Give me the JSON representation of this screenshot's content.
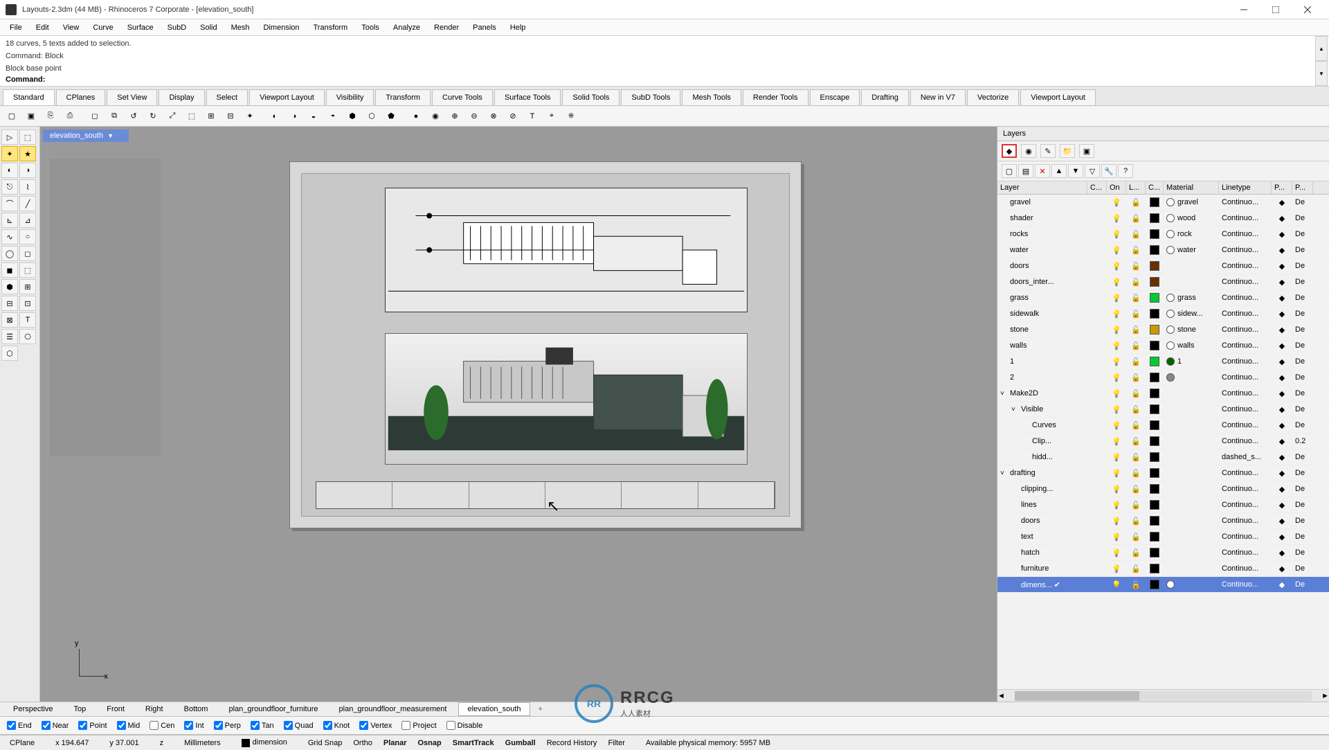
{
  "window": {
    "title": "Layouts-2.3dm (44 MB) - Rhinoceros 7 Corporate - [elevation_south]"
  },
  "menu": [
    "File",
    "Edit",
    "View",
    "Curve",
    "Surface",
    "SubD",
    "Solid",
    "Mesh",
    "Dimension",
    "Transform",
    "Tools",
    "Analyze",
    "Render",
    "Panels",
    "Help"
  ],
  "command_history": [
    "18 curves, 5 texts added to selection.",
    "Command: Block",
    "Block base point"
  ],
  "command_prompt": "Command:",
  "tabs": [
    "Standard",
    "CPlanes",
    "Set View",
    "Display",
    "Select",
    "Viewport Layout",
    "Visibility",
    "Transform",
    "Curve Tools",
    "Surface Tools",
    "Solid Tools",
    "SubD Tools",
    "Mesh Tools",
    "Render Tools",
    "Enscape",
    "Drafting",
    "New in V7",
    "Vectorize",
    "Viewport Layout"
  ],
  "viewport": {
    "name": "elevation_south",
    "axes": {
      "x": "x",
      "y": "y"
    }
  },
  "layers_panel": {
    "title": "Layers",
    "columns": [
      "Layer",
      "C...",
      "On",
      "L...",
      "C...",
      "Material",
      "Linetype",
      "P...",
      "P..."
    ],
    "rows": [
      {
        "name": "gravel",
        "color": "#000000",
        "material": "gravel",
        "linetype": "Continuo...",
        "pc": "De"
      },
      {
        "name": "shader",
        "color": "#000000",
        "material": "wood",
        "linetype": "Continuo...",
        "pc": "De"
      },
      {
        "name": "rocks",
        "color": "#000000",
        "material": "rock",
        "linetype": "Continuo...",
        "pc": "De"
      },
      {
        "name": "water",
        "color": "#000000",
        "material": "water",
        "linetype": "Continuo...",
        "pc": "De"
      },
      {
        "name": "doors",
        "color": "#663300",
        "material": "",
        "linetype": "Continuo...",
        "pc": "De"
      },
      {
        "name": "doors_inter...",
        "color": "#663300",
        "material": "",
        "linetype": "Continuo...",
        "pc": "De"
      },
      {
        "name": "grass",
        "color": "#00cc33",
        "material": "grass",
        "linetype": "Continuo...",
        "pc": "De",
        "prcolor": "#00cc33"
      },
      {
        "name": "sidewalk",
        "color": "#000000",
        "material": "sidew...",
        "linetype": "Continuo...",
        "pc": "De"
      },
      {
        "name": "stone",
        "color": "#cc9900",
        "material": "stone",
        "linetype": "Continuo...",
        "pc": "De"
      },
      {
        "name": "walls",
        "color": "#000000",
        "material": "walls",
        "linetype": "Continuo...",
        "pc": "De"
      },
      {
        "name": "1",
        "color": "#00cc33",
        "material": "1",
        "linetype": "Continuo...",
        "pc": "De",
        "matcolor": "#006600"
      },
      {
        "name": "2",
        "color": "#000000",
        "material": "",
        "linetype": "Continuo...",
        "pc": "De",
        "matcolor": "#888888"
      },
      {
        "name": "Make2D",
        "color": "#000000",
        "material": "",
        "linetype": "Continuo...",
        "pc": "De",
        "expandable": true,
        "expanded": true
      },
      {
        "name": "Visible",
        "color": "#000000",
        "material": "",
        "linetype": "Continuo...",
        "pc": "De",
        "indent": 1,
        "expandable": true,
        "expanded": true
      },
      {
        "name": "Curves",
        "color": "#000000",
        "material": "",
        "linetype": "Continuo...",
        "pc": "De",
        "indent": 2
      },
      {
        "name": "Clip...",
        "color": "#000000",
        "material": "",
        "linetype": "Continuo...",
        "pc": "0.2",
        "indent": 2
      },
      {
        "name": "hidd...",
        "color": "#000000",
        "material": "",
        "linetype": "dashed_s...",
        "pc": "De",
        "indent": 2
      },
      {
        "name": "drafting",
        "color": "#000000",
        "material": "",
        "linetype": "Continuo...",
        "pc": "De",
        "expandable": true,
        "expanded": true
      },
      {
        "name": "clipping...",
        "color": "#000000",
        "material": "",
        "linetype": "Continuo...",
        "pc": "De",
        "indent": 1
      },
      {
        "name": "lines",
        "color": "#000000",
        "material": "",
        "linetype": "Continuo...",
        "pc": "De",
        "indent": 1
      },
      {
        "name": "doors",
        "color": "#000000",
        "material": "",
        "linetype": "Continuo...",
        "pc": "De",
        "indent": 1
      },
      {
        "name": "text",
        "color": "#000000",
        "material": "",
        "linetype": "Continuo...",
        "pc": "De",
        "indent": 1
      },
      {
        "name": "hatch",
        "color": "#000000",
        "material": "",
        "linetype": "Continuo...",
        "pc": "De",
        "indent": 1
      },
      {
        "name": "furniture",
        "color": "#000000",
        "material": "",
        "linetype": "Continuo...",
        "pc": "De",
        "indent": 1
      },
      {
        "name": "dimens...",
        "color": "#000000",
        "material": "",
        "linetype": "Continuo...",
        "pc": "De",
        "indent": 1,
        "selected": true,
        "checked": true,
        "matcolor": "#ffffff"
      }
    ]
  },
  "view_tabs": [
    "Perspective",
    "Top",
    "Front",
    "Right",
    "Bottom",
    "plan_groundfloor_furniture",
    "plan_groundfloor_measurement",
    "elevation_south"
  ],
  "active_view_tab": "elevation_south",
  "osnaps": [
    {
      "label": "End",
      "checked": true
    },
    {
      "label": "Near",
      "checked": true
    },
    {
      "label": "Point",
      "checked": true
    },
    {
      "label": "Mid",
      "checked": true
    },
    {
      "label": "Cen",
      "checked": false
    },
    {
      "label": "Int",
      "checked": true
    },
    {
      "label": "Perp",
      "checked": true
    },
    {
      "label": "Tan",
      "checked": true
    },
    {
      "label": "Quad",
      "checked": true
    },
    {
      "label": "Knot",
      "checked": true
    },
    {
      "label": "Vertex",
      "checked": true
    },
    {
      "label": "Project",
      "checked": false
    },
    {
      "label": "Disable",
      "checked": false
    }
  ],
  "status": {
    "cplane": "CPlane",
    "x": "x 194.647",
    "y": "y 37.001",
    "z": "z",
    "units": "Millimeters",
    "layer": "dimension",
    "toggles": [
      "Grid Snap",
      "Ortho",
      "Planar",
      "Osnap",
      "SmartTrack",
      "Gumball",
      "Record History",
      "Filter"
    ],
    "bold_toggles": [
      "Planar",
      "Osnap",
      "SmartTrack",
      "Gumball"
    ],
    "memory": "Available physical memory: 5957 MB"
  },
  "watermark": {
    "logo": "RR",
    "t1": "RRCG",
    "t2": "人人素材"
  }
}
